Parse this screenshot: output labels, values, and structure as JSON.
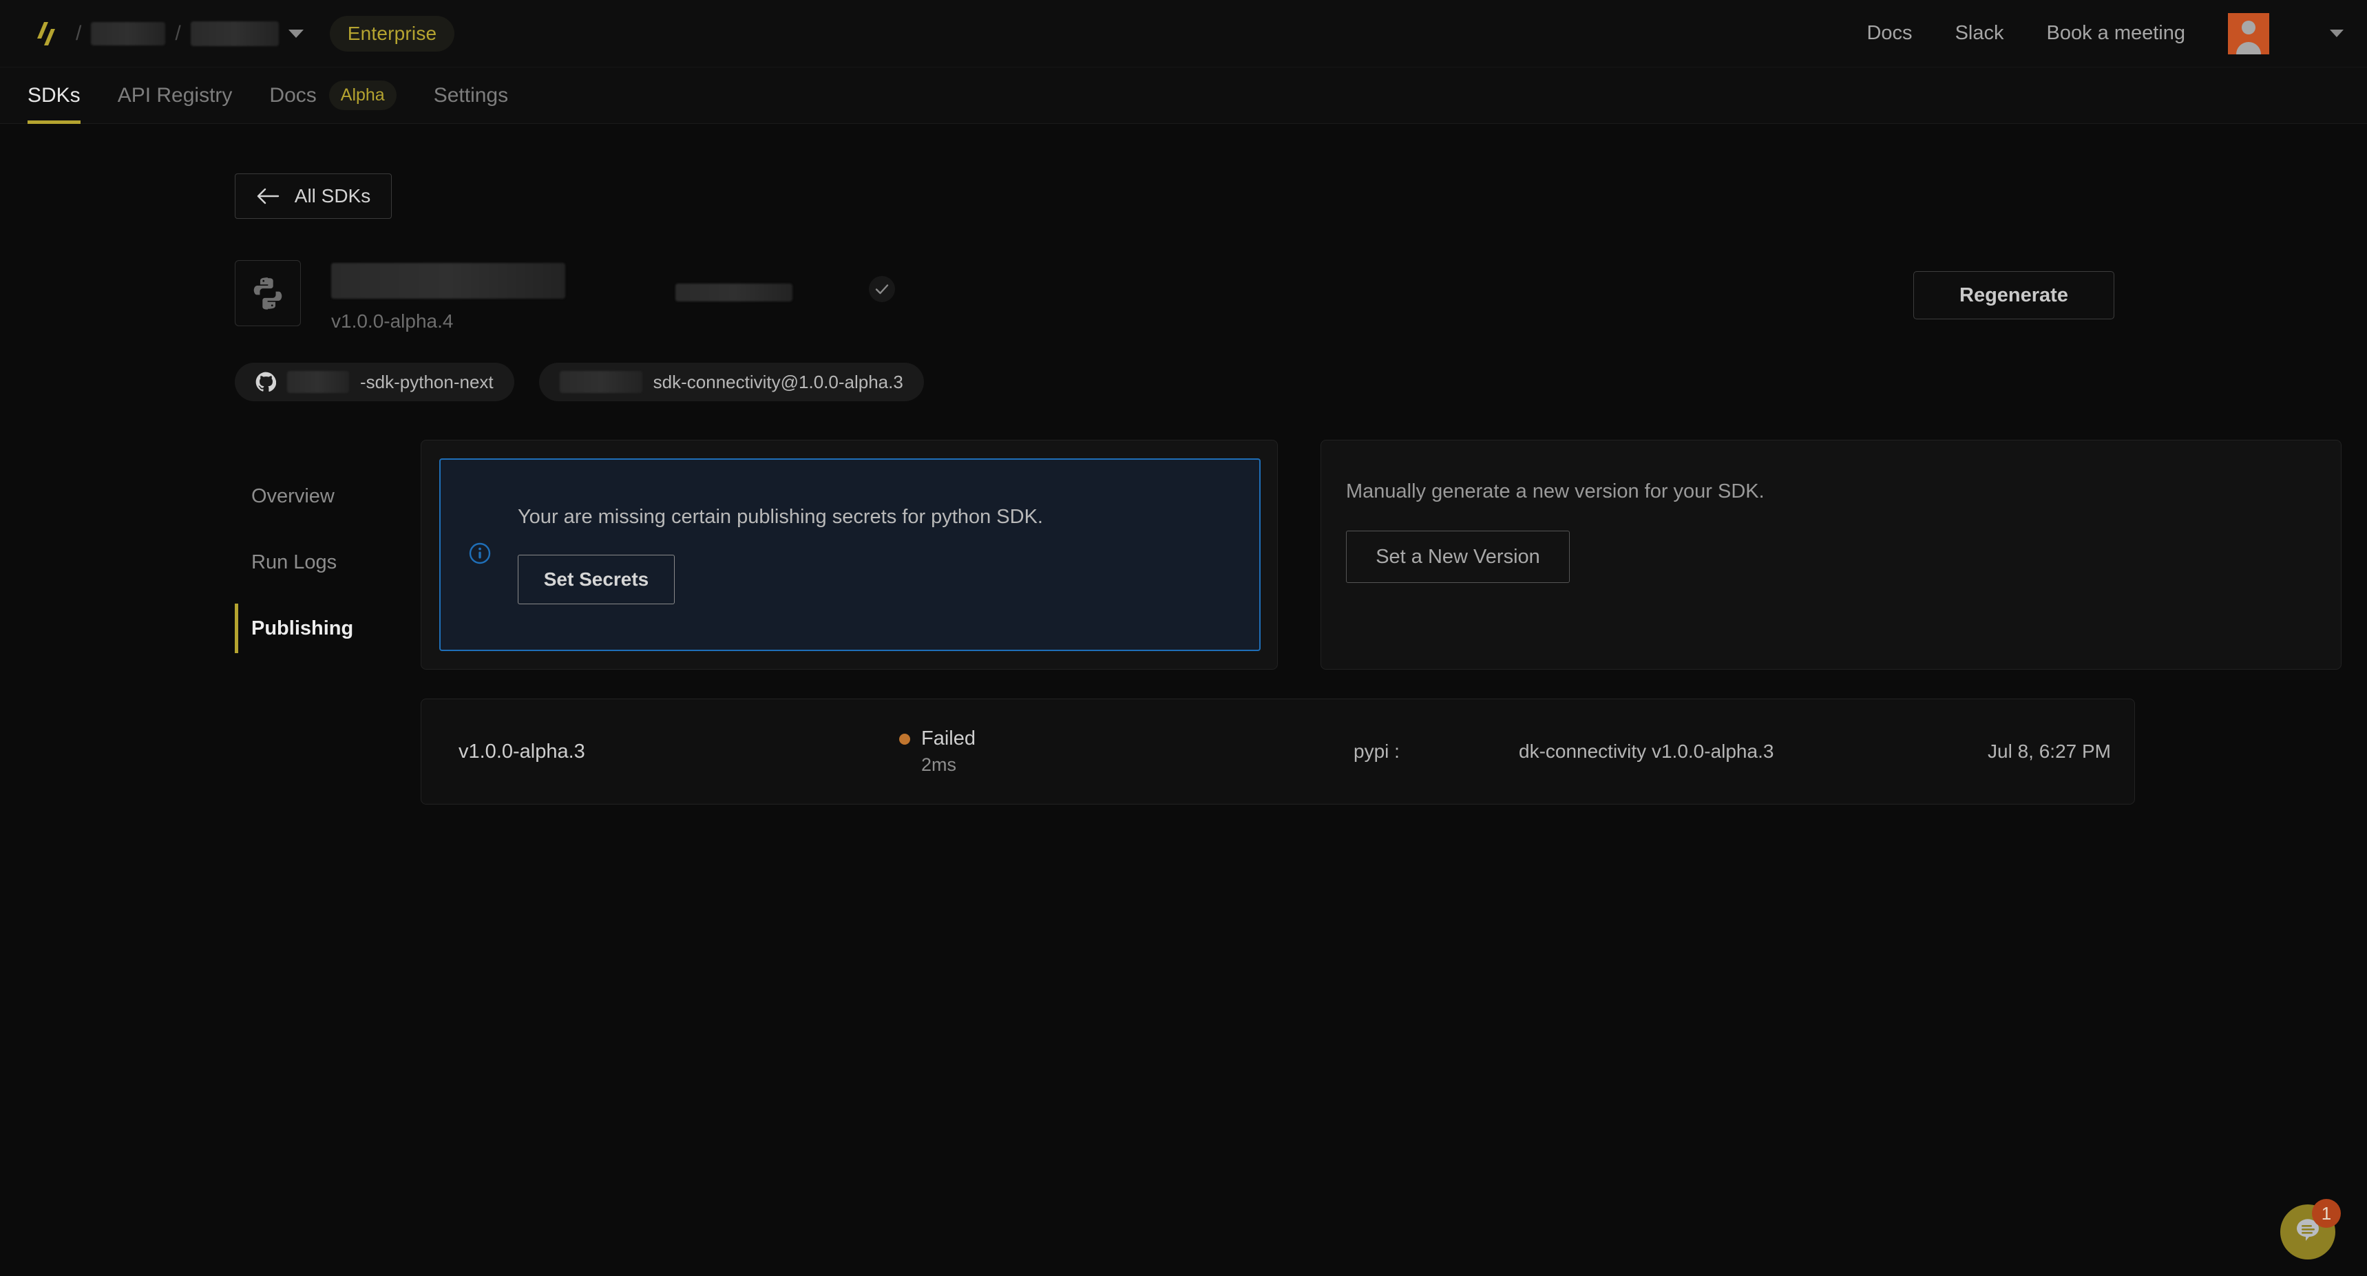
{
  "header": {
    "logo_icon": "slashes-logo-icon",
    "breadcrumb_separator": "/",
    "org_redacted": "",
    "project_redacted": "",
    "project_chevron_icon": "chevron-down-icon",
    "plan_badge": "Enterprise",
    "links": [
      {
        "label": "Docs",
        "name": "docs-link"
      },
      {
        "label": "Slack",
        "name": "slack-link"
      },
      {
        "label": "Book a meeting",
        "name": "book-a-meeting-link"
      }
    ],
    "avatar_icon": "user-avatar-icon",
    "avatar_color": "#c75323",
    "account_chevron_icon": "chevron-down-icon"
  },
  "tabs": [
    {
      "label": "SDKs",
      "active": true,
      "badge": ""
    },
    {
      "label": "API Registry",
      "active": false,
      "badge": ""
    },
    {
      "label": "Docs",
      "active": false,
      "badge": "Alpha"
    },
    {
      "label": "Settings",
      "active": false,
      "badge": ""
    }
  ],
  "back_button": {
    "label": "All SDKs",
    "icon": "arrow-left-icon"
  },
  "sdk": {
    "language_icon": "python-icon",
    "name_redacted": "",
    "version": "v1.0.0-alpha.4",
    "status_icon": "check-circle-icon",
    "regenerate_label": "Regenerate",
    "chips": [
      {
        "icon": "github-icon",
        "redacted": "",
        "label": "-sdk-python-next"
      },
      {
        "icon": "",
        "redacted": "",
        "label": "sdk-connectivity@1.0.0-alpha.3"
      }
    ]
  },
  "sidenav": [
    {
      "label": "Overview",
      "active": false
    },
    {
      "label": "Run Logs",
      "active": false
    },
    {
      "label": "Publishing",
      "active": true
    }
  ],
  "alert": {
    "icon": "info-circle-icon",
    "message": "Your are missing certain publishing secrets for python SDK.",
    "action_label": "Set Secrets",
    "border_color": "#1f6fb8",
    "background_color": "#141c29"
  },
  "generate_panel": {
    "message": "Manually generate a new version for your SDK.",
    "action_label": "Set a New Version"
  },
  "publish_table": {
    "rows": [
      {
        "version": "v1.0.0-alpha.3",
        "status": "Failed",
        "status_color": "#c0752e",
        "duration": "2ms",
        "target": "pypi :",
        "package": "dk-connectivity v1.0.0-alpha.3",
        "date": "Jul 8, 6:27 PM"
      }
    ]
  },
  "chat_widget": {
    "icon": "chat-bubble-icon",
    "badge_count": "1",
    "color": "#8e8023",
    "badge_color": "#b4441a"
  }
}
